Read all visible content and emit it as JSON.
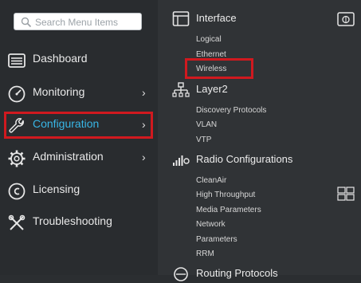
{
  "search": {
    "placeholder": "Search Menu Items"
  },
  "sidebar": {
    "items": [
      {
        "label": "Dashboard",
        "icon": "dashboard-icon",
        "has_chevron": false
      },
      {
        "label": "Monitoring",
        "icon": "monitoring-gauge-icon",
        "has_chevron": true
      },
      {
        "label": "Configuration",
        "icon": "wrench-icon",
        "has_chevron": true,
        "active": true
      },
      {
        "label": "Administration",
        "icon": "gear-icon",
        "has_chevron": true
      },
      {
        "label": "Licensing",
        "icon": "licensing-icon",
        "has_chevron": false
      },
      {
        "label": "Troubleshooting",
        "icon": "tools-icon",
        "has_chevron": false
      }
    ],
    "chevron": "›"
  },
  "panel": {
    "sections": [
      {
        "title": "Interface",
        "icon": "interface-icon",
        "items": [
          "Logical",
          "Ethernet",
          "Wireless"
        ]
      },
      {
        "title": "Layer2",
        "icon": "layer2-tree-icon",
        "items": [
          "Discovery Protocols",
          "VLAN",
          "VTP"
        ]
      },
      {
        "title": "Radio Configurations",
        "icon": "radio-signal-icon",
        "items": [
          "CleanAir",
          "High Throughput",
          "Media Parameters",
          "Network",
          "Parameters",
          "RRM"
        ]
      },
      {
        "title": "Routing Protocols",
        "icon": "routing-icon",
        "items": []
      }
    ]
  },
  "colors": {
    "active_text": "#38b6e6",
    "highlight_border": "#d0191f",
    "sidebar_bg": "#292c2f",
    "panel_bg": "#303336"
  }
}
